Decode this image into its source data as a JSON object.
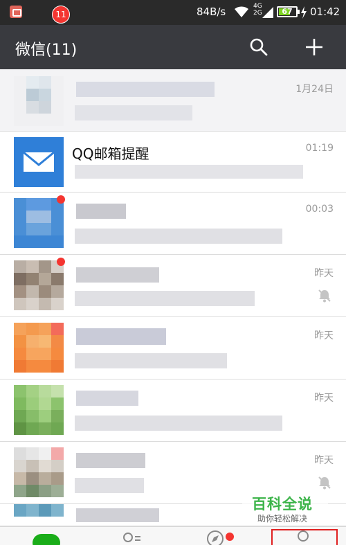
{
  "status_bar": {
    "net_speed": "84B/s",
    "net_type_top": "4G",
    "net_type_bottom": "2G",
    "battery": "67",
    "battery_level": 0.67,
    "time": "01:42"
  },
  "title_bar": {
    "title": "微信(11)",
    "search_icon": "search-icon",
    "add_icon": "plus-icon"
  },
  "chats": [
    {
      "name": "",
      "time": "1月24日",
      "preview": "",
      "pinned": true
    },
    {
      "name": "QQ邮箱提醒",
      "time": "01:19",
      "preview": ""
    },
    {
      "name": "",
      "time": "00:03",
      "preview": ""
    },
    {
      "name": "",
      "time": "昨天",
      "preview": "",
      "muted": true
    },
    {
      "name": "",
      "time": "昨天",
      "preview": ""
    },
    {
      "name": "",
      "time": "昨天",
      "preview": ""
    },
    {
      "name": "",
      "time": "昨天",
      "preview": "",
      "muted": true
    }
  ],
  "bottom_nav": {
    "unread_count": "11"
  },
  "watermark": {
    "title": "百科全说",
    "subtitle": "助你轻松解决"
  },
  "colors": {
    "title_bar": "#393a3f",
    "status_bar": "#2a2a2a",
    "badge": "#f43530",
    "wechat_green": "#1aad19",
    "mail_blue": "#2f7fd8"
  }
}
